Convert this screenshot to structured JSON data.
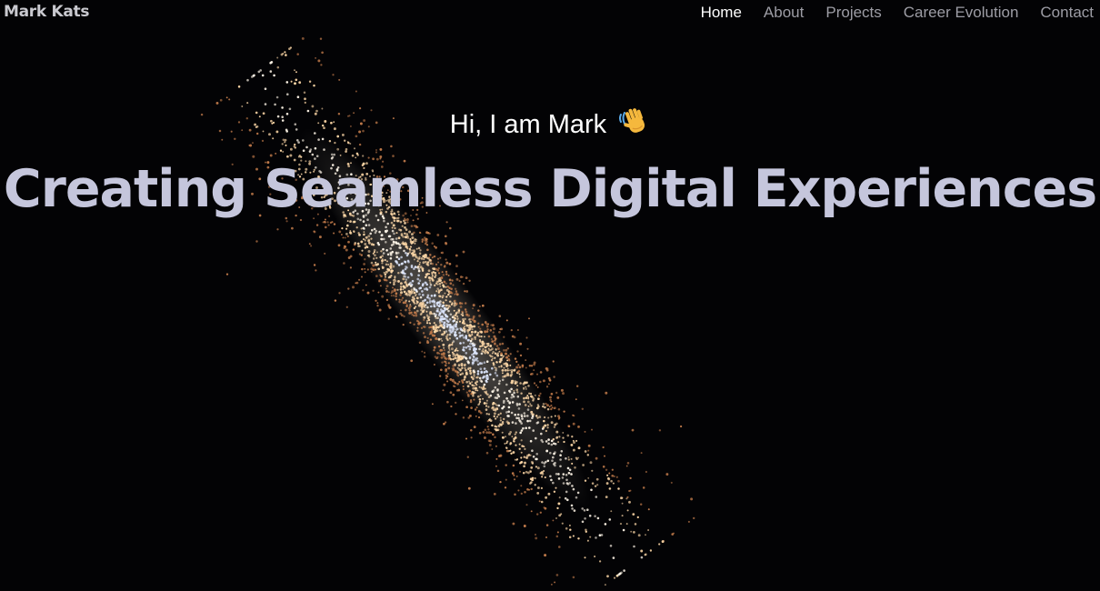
{
  "brand": {
    "name": "Mark Kats"
  },
  "nav": {
    "items": [
      {
        "label": "Home",
        "active": true
      },
      {
        "label": "About",
        "active": false
      },
      {
        "label": "Projects",
        "active": false
      },
      {
        "label": "Career Evolution",
        "active": false
      },
      {
        "label": "Contact",
        "active": false
      }
    ]
  },
  "hero": {
    "greeting": "Hi, I am Mark",
    "greeting_icon": "waving-hand-icon",
    "headline": "Creating Seamless Digital Experiences"
  },
  "colors": {
    "background": "#030305",
    "brand_text": "#c9c9cf",
    "nav_active": "#ffffff",
    "nav_inactive": "#9d9da5",
    "headline": "#c5c6dc",
    "galaxy_core": "#fff6e8",
    "galaxy_mid": "#ffd9a8",
    "galaxy_outer": "#c07a4a",
    "galaxy_inner_blue": "#dfe8ff"
  }
}
